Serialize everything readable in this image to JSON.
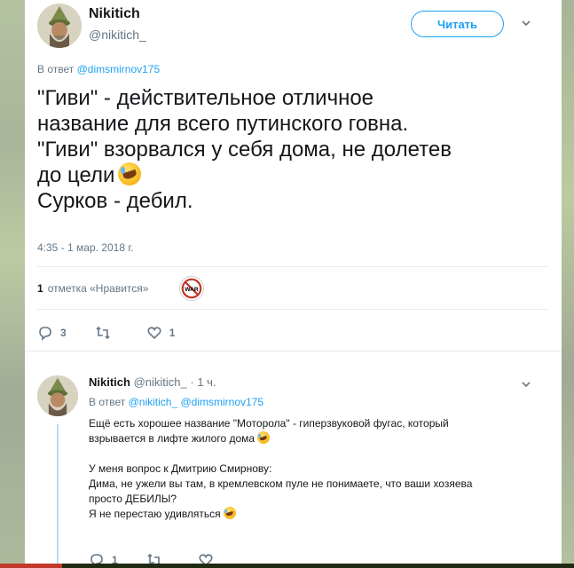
{
  "tweet": {
    "author_name": "Nikitich",
    "author_handle": "@nikitich_",
    "follow_label": "Читать",
    "reply_prefix": "В ответ",
    "reply_mention": "@dimsmirnov175",
    "text_lines": [
      "\"Гиви\" - действительное отличное",
      "название для всего путинского говна.",
      "\"Гиви\" взорвался у себя дома, не долетев",
      "до цели",
      "Сурков - дебил."
    ],
    "timestamp": "4:35 - 1 мар. 2018 г.",
    "likes_count": "1",
    "likes_label": "отметка «Нравится»",
    "liker_avatar_text": "WAR",
    "actions": {
      "reply_count": "3",
      "retweet_count": "",
      "like_count": "1"
    }
  },
  "reply": {
    "author_name": "Nikitich",
    "author_handle": "@nikitich_",
    "time": "· 1 ч.",
    "reply_prefix": "В ответ",
    "reply_mentions": "@nikitich_ @dimsmirnov175",
    "lines": [
      "Ещё есть хорошее название \"Моторола\" - гиперзвуковой фугас, который",
      "взрывается в лифте жилого дома",
      "",
      "У меня вопрос к Дмитрию Смирнову:",
      "Дима, не ужели вы там, в кремлевском пуле не понимаете, что ваши хозяева",
      "просто ДЕБИЛЫ?",
      "Я не перестаю удивляться"
    ],
    "actions": {
      "reply_count": "1",
      "retweet_count": "",
      "like_count": ""
    }
  },
  "colors": {
    "accent": "#1da1f2",
    "muted": "#657786",
    "text": "#14171a",
    "divider": "#e6ecf0"
  }
}
